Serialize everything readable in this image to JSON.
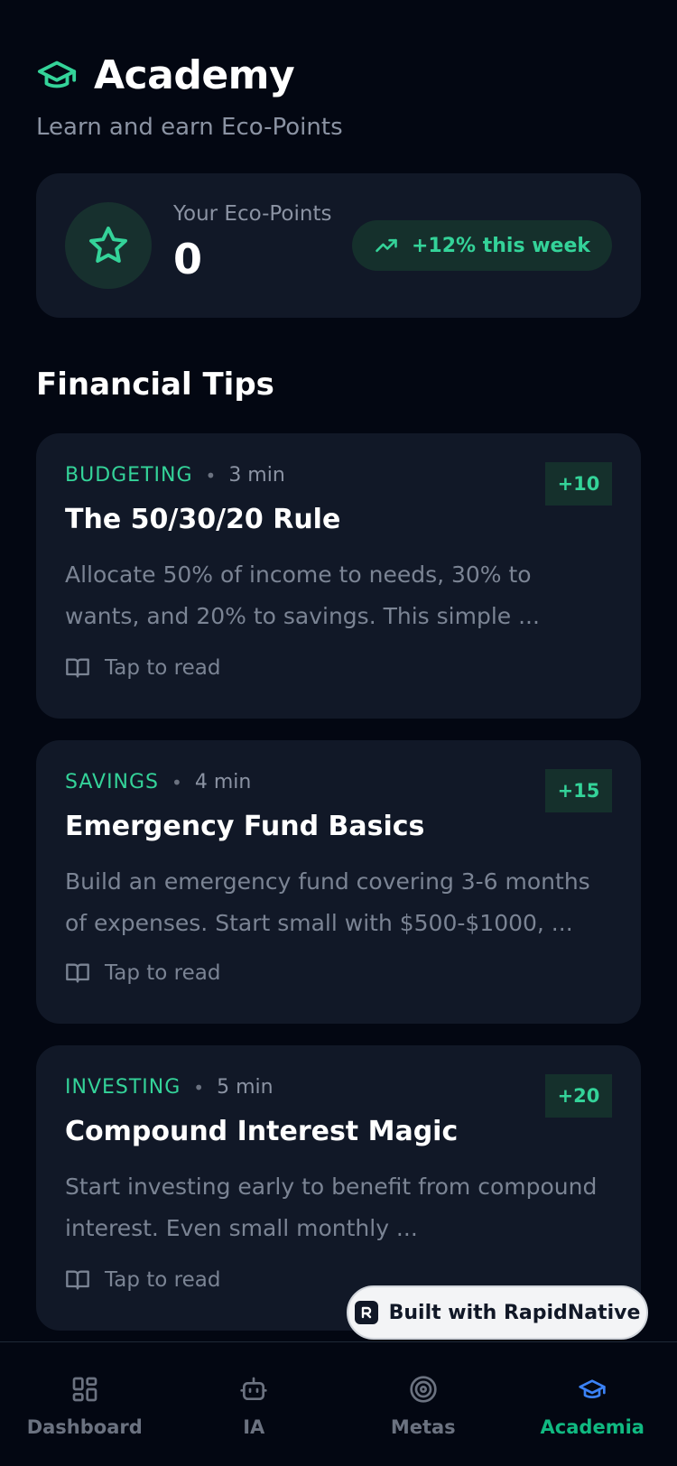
{
  "header": {
    "title": "Academy",
    "subtitle": "Learn and earn Eco-Points",
    "icon": "graduation-cap-icon"
  },
  "points": {
    "label": "Your Eco-Points",
    "value": "0",
    "trend": "+12% this week",
    "icon": "star-icon"
  },
  "section_title": "Financial Tips",
  "tips": [
    {
      "category": "BUDGETING",
      "time": "3 min",
      "points": "+10",
      "title": "The 50/30/20 Rule",
      "body": "Allocate 50% of income to needs, 30% to wants, and 20% to savings. This simple ...",
      "cta": "Tap to read"
    },
    {
      "category": "SAVINGS",
      "time": "4 min",
      "points": "+15",
      "title": "Emergency Fund Basics",
      "body": "Build an emergency fund covering 3-6 months of expenses. Start small with $500-$1000, ...",
      "cta": "Tap to read"
    },
    {
      "category": "INVESTING",
      "time": "5 min",
      "points": "+20",
      "title": "Compound Interest Magic",
      "body": "Start investing early to benefit from compound interest. Even small monthly ...",
      "cta": "Tap to read"
    }
  ],
  "built_with": "Built with RapidNative",
  "nav": [
    {
      "label": "Dashboard",
      "icon": "dashboard-icon",
      "active": false
    },
    {
      "label": "IA",
      "icon": "robot-icon",
      "active": false
    },
    {
      "label": "Metas",
      "icon": "target-icon",
      "active": false
    },
    {
      "label": "Academia",
      "icon": "graduation-cap-icon",
      "active": true
    }
  ],
  "colors": {
    "background": "#030712",
    "card": "#111827",
    "accent": "#34d399",
    "nav_active": "#3b82f6"
  }
}
